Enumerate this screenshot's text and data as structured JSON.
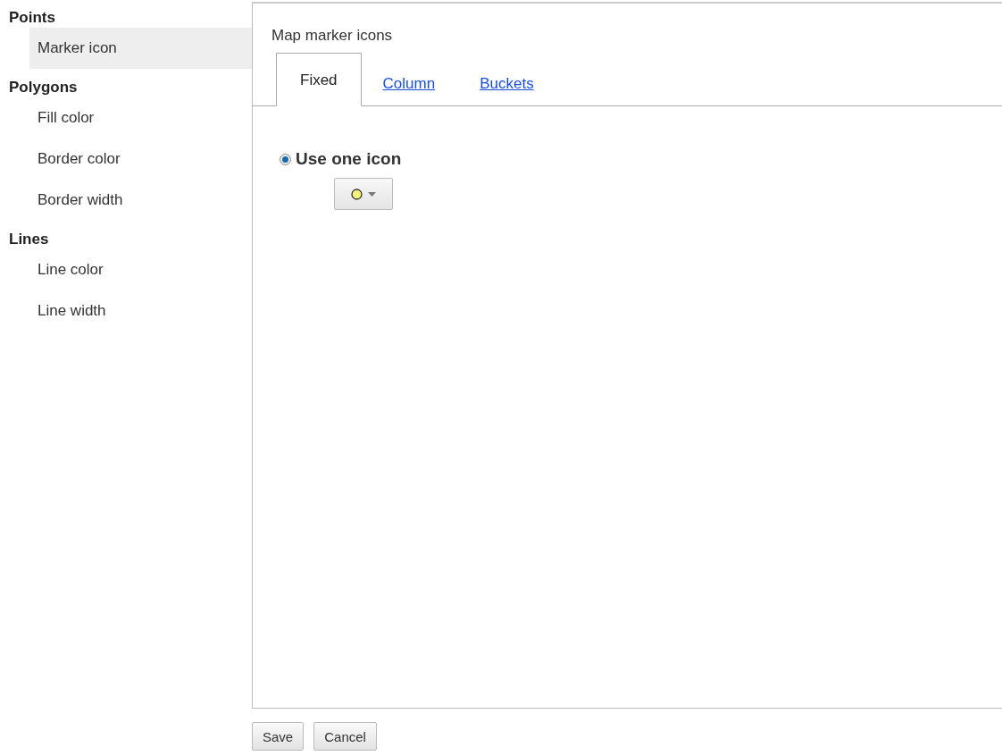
{
  "sidebar": {
    "groups": [
      {
        "title": "Points",
        "items": [
          {
            "label": "Marker icon",
            "selected": true
          }
        ]
      },
      {
        "title": "Polygons",
        "items": [
          {
            "label": "Fill color",
            "selected": false
          },
          {
            "label": "Border color",
            "selected": false
          },
          {
            "label": "Border width",
            "selected": false
          }
        ]
      },
      {
        "title": "Lines",
        "items": [
          {
            "label": "Line color",
            "selected": false
          },
          {
            "label": "Line width",
            "selected": false
          }
        ]
      }
    ]
  },
  "panel": {
    "title": "Map marker icons",
    "tabs": [
      {
        "label": "Fixed",
        "selected": true
      },
      {
        "label": "Column",
        "selected": false
      },
      {
        "label": "Buckets",
        "selected": false
      }
    ],
    "option": {
      "label": "Use one icon",
      "selected": true
    },
    "icon_picker": {
      "color": "#f5f07a"
    }
  },
  "buttons": [
    {
      "label": "Save"
    },
    {
      "label": "Cancel"
    }
  ]
}
